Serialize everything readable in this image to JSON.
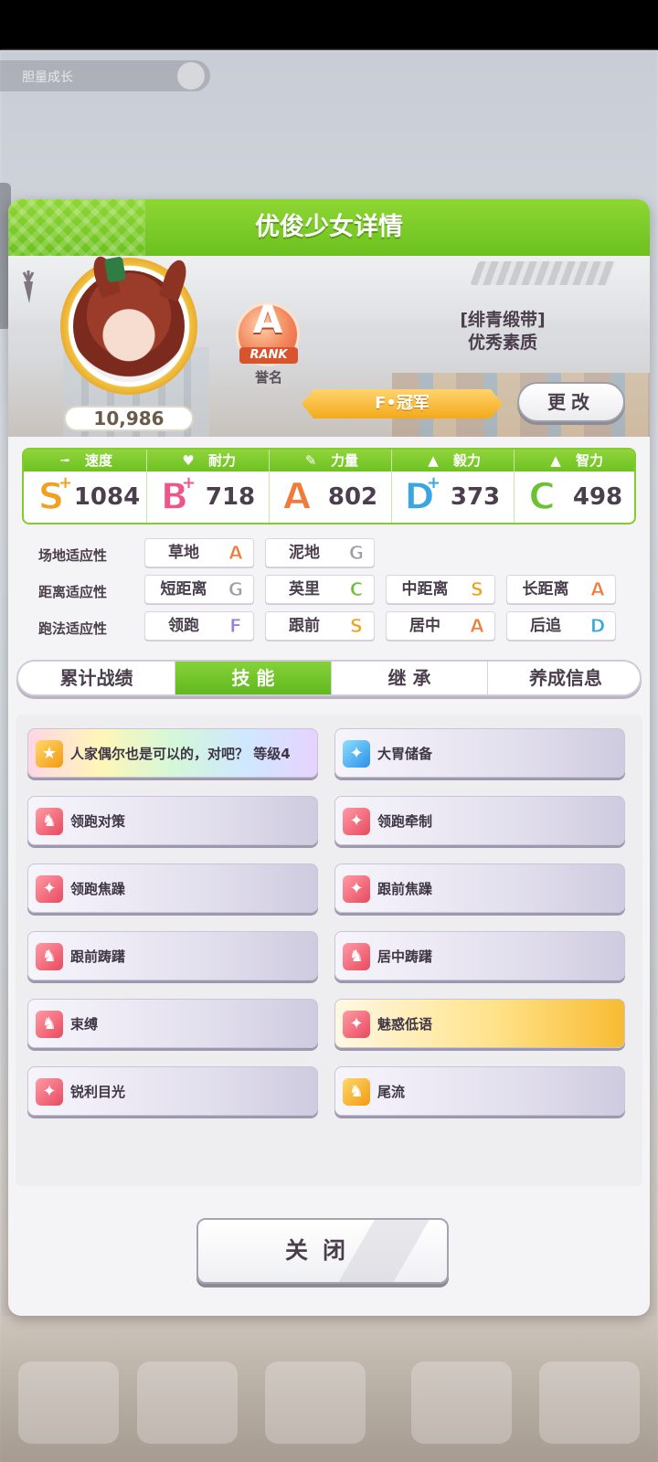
{
  "background": {
    "topbar_text": "胆量成长"
  },
  "dialog": {
    "title": "优俊少女详情",
    "close_label": "关闭"
  },
  "profile": {
    "fans": "10,986",
    "rank_letter": "A",
    "rank_ribbon": "RANK",
    "rank_caption": "誉名",
    "title_line1": "[绯青缎带]",
    "title_line2": "优秀素质",
    "epithet": "F•冠军",
    "change_label": "更改"
  },
  "stats": [
    {
      "label": "速度",
      "icon": "shoe-icon",
      "grade": "S",
      "plus": "+",
      "value": "1084"
    },
    {
      "label": "耐力",
      "icon": "heart-icon",
      "grade": "B",
      "plus": "+",
      "value": "718"
    },
    {
      "label": "力量",
      "icon": "muscle-icon",
      "grade": "A",
      "plus": "",
      "value": "802"
    },
    {
      "label": "毅力",
      "icon": "flame-icon",
      "grade": "D",
      "plus": "+",
      "value": "373"
    },
    {
      "label": "智力",
      "icon": "graduation-cap-icon",
      "grade": "C",
      "plus": "",
      "value": "498"
    }
  ],
  "aptitude": {
    "track_label": "场地适应性",
    "distance_label": "距离适应性",
    "style_label": "跑法适应性",
    "track": [
      {
        "name": "草地",
        "grade": "A"
      },
      {
        "name": "泥地",
        "grade": "G"
      }
    ],
    "distance": [
      {
        "name": "短距离",
        "grade": "G"
      },
      {
        "name": "英里",
        "grade": "C"
      },
      {
        "name": "中距离",
        "grade": "S"
      },
      {
        "name": "长距离",
        "grade": "A"
      }
    ],
    "style": [
      {
        "name": "领跑",
        "grade": "F"
      },
      {
        "name": "跟前",
        "grade": "S"
      },
      {
        "name": "居中",
        "grade": "A"
      },
      {
        "name": "后追",
        "grade": "D"
      }
    ]
  },
  "tabs": [
    "累计战绩",
    "技 能",
    "继 承",
    "养成信息"
  ],
  "active_tab": 1,
  "skills": [
    {
      "name": "人家偶尔也是可以的，对吧？ 等级4",
      "icon": "unique-skill-icon",
      "style": "rainbow"
    },
    {
      "name": "大胃储备",
      "icon": "recovery-sparkle-icon",
      "style": "normal"
    },
    {
      "name": "领跑对策",
      "icon": "debuff-horse-icon",
      "style": "normal"
    },
    {
      "name": "领跑牵制",
      "icon": "debuff-sparkle-icon",
      "style": "normal"
    },
    {
      "name": "领跑焦躁",
      "icon": "debuff-sparkle-icon",
      "style": "normal"
    },
    {
      "name": "跟前焦躁",
      "icon": "debuff-sparkle-icon",
      "style": "normal"
    },
    {
      "name": "跟前踌躇",
      "icon": "debuff-horse-icon",
      "style": "normal"
    },
    {
      "name": "居中踌躇",
      "icon": "debuff-horse-icon",
      "style": "normal"
    },
    {
      "name": "束缚",
      "icon": "debuff-horse-icon",
      "style": "normal"
    },
    {
      "name": "魅惑低语",
      "icon": "debuff-sparkle-icon",
      "style": "gold"
    },
    {
      "name": "锐利目光",
      "icon": "debuff-sparkle-icon",
      "style": "normal"
    },
    {
      "name": "尾流",
      "icon": "speed-horse-icon",
      "style": "normal"
    }
  ],
  "colors": {
    "header_green": "#7ccb28",
    "grade_S": "#f0a11f",
    "grade_A": "#f07a3a",
    "grade_B": "#f0558a",
    "grade_C": "#6cc233",
    "grade_D": "#3aa6e0",
    "grade_F": "#9b7be0",
    "grade_G": "#9ea0a6"
  }
}
